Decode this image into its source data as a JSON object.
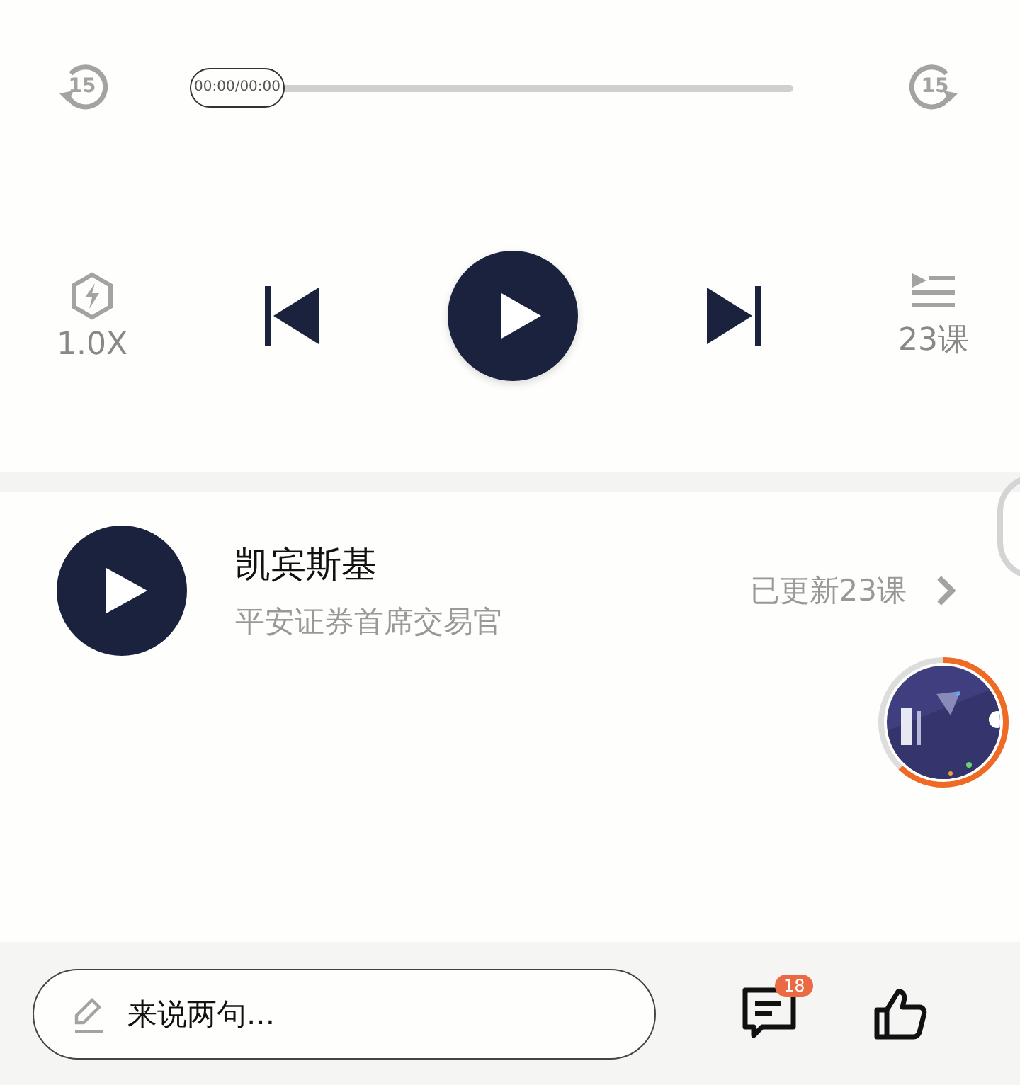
{
  "player": {
    "rewind_label": "15",
    "forward_label": "15",
    "time": "00:00/00:00"
  },
  "controls": {
    "speed": "1.0X",
    "lessons": "23课"
  },
  "author": {
    "name": "凯宾斯基",
    "title": "平安证券首席交易官",
    "updates": "已更新23课"
  },
  "float_player": {
    "level": 0.62
  },
  "bottom": {
    "placeholder": "来说两句...",
    "comment_count": "18"
  }
}
